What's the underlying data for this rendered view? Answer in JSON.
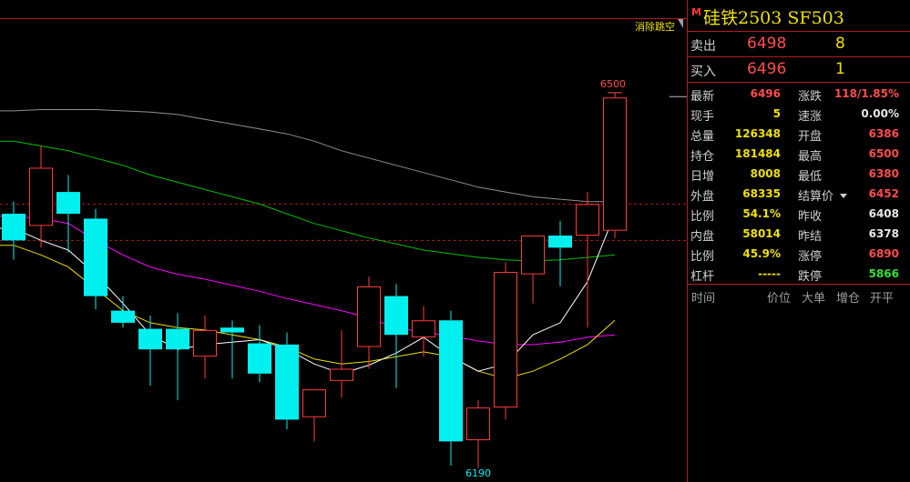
{
  "toolbar": {
    "gap_label": "消除跳空"
  },
  "contract": {
    "m_badge": "M",
    "title": "硅铁2503  SF503"
  },
  "quote": {
    "ask_label": "卖出",
    "ask_price": "6498",
    "ask_vol": "8",
    "bid_label": "买入",
    "bid_price": "6496",
    "bid_vol": "1"
  },
  "stats": {
    "left": [
      {
        "label": "最新",
        "value": "6496",
        "color": "red"
      },
      {
        "label": "现手",
        "value": "5",
        "color": "yellow"
      },
      {
        "label": "总量",
        "value": "126348",
        "color": "yellow"
      },
      {
        "label": "持仓",
        "value": "181484",
        "color": "yellow"
      },
      {
        "label": "日增",
        "value": "8008",
        "color": "yellow"
      },
      {
        "label": "外盘",
        "value": "68335",
        "color": "yellow"
      },
      {
        "label": "比例",
        "value": "54.1%",
        "color": "yellow"
      },
      {
        "label": "内盘",
        "value": "58014",
        "color": "yellow"
      },
      {
        "label": "比例",
        "value": "45.9%",
        "color": "yellow"
      },
      {
        "label": "杠杆",
        "value": "-----",
        "color": "yellow"
      }
    ],
    "right": [
      {
        "label": "涨跌",
        "value": "118/1.85%",
        "color": "red"
      },
      {
        "label": "速涨",
        "value": "0.00%",
        "color": "white"
      },
      {
        "label": "开盘",
        "value": "6386",
        "color": "red"
      },
      {
        "label": "最高",
        "value": "6500",
        "color": "red"
      },
      {
        "label": "最低",
        "value": "6380",
        "color": "red"
      },
      {
        "label": "结算价",
        "value": "6452",
        "color": "red"
      },
      {
        "label": "昨收",
        "value": "6408",
        "color": "white"
      },
      {
        "label": "昨结",
        "value": "6378",
        "color": "white"
      },
      {
        "label": "涨停",
        "value": "6890",
        "color": "red"
      },
      {
        "label": "跌停",
        "value": "5866",
        "color": "green"
      }
    ]
  },
  "ticks_header": {
    "time": "时间",
    "price": "价位",
    "big": "大单",
    "oi_change": "增仓",
    "open_close": "开平"
  },
  "colors": {
    "up": "#ff3b3b",
    "down": "#00f0f0",
    "grid": "#b21c1c",
    "ma5": "#ffffff",
    "ma10": "#f0e000",
    "ma20": "#ff00ff",
    "ma40": "#00c000",
    "ma60": "#909090"
  },
  "chart_labels": {
    "high_label": "6500",
    "low_label": "6190"
  },
  "chart_data": {
    "type": "candlestick",
    "ylim": [
      6180,
      6560
    ],
    "reference_lines": [
      6408,
      6378
    ],
    "candles": [
      {
        "o": 6400,
        "h": 6410,
        "l": 6362,
        "c": 6378
      },
      {
        "o": 6390,
        "h": 6456,
        "l": 6372,
        "c": 6438
      },
      {
        "o": 6418,
        "h": 6432,
        "l": 6368,
        "c": 6400
      },
      {
        "o": 6396,
        "h": 6404,
        "l": 6321,
        "c": 6332
      },
      {
        "o": 6320,
        "h": 6332,
        "l": 6306,
        "c": 6310
      },
      {
        "o": 6305,
        "h": 6316,
        "l": 6258,
        "c": 6288
      },
      {
        "o": 6305,
        "h": 6318,
        "l": 6246,
        "c": 6288
      },
      {
        "o": 6282,
        "h": 6316,
        "l": 6264,
        "c": 6304
      },
      {
        "o": 6306,
        "h": 6312,
        "l": 6264,
        "c": 6302
      },
      {
        "o": 6293,
        "h": 6308,
        "l": 6261,
        "c": 6268
      },
      {
        "o": 6292,
        "h": 6302,
        "l": 6222,
        "c": 6230
      },
      {
        "o": 6232,
        "h": 6252,
        "l": 6212,
        "c": 6255
      },
      {
        "o": 6262,
        "h": 6304,
        "l": 6248,
        "c": 6272
      },
      {
        "o": 6290,
        "h": 6348,
        "l": 6272,
        "c": 6340
      },
      {
        "o": 6332,
        "h": 6342,
        "l": 6256,
        "c": 6300
      },
      {
        "o": 6298,
        "h": 6324,
        "l": 6282,
        "c": 6312
      },
      {
        "o": 6312,
        "h": 6320,
        "l": 6192,
        "c": 6212
      },
      {
        "o": 6213,
        "h": 6246,
        "l": 6190,
        "c": 6240
      },
      {
        "o": 6240,
        "h": 6360,
        "l": 6230,
        "c": 6352
      },
      {
        "o": 6350,
        "h": 6378,
        "l": 6326,
        "c": 6382
      },
      {
        "o": 6382,
        "h": 6394,
        "l": 6340,
        "c": 6372
      },
      {
        "o": 6382,
        "h": 6418,
        "l": 6306,
        "c": 6408
      },
      {
        "o": 6386,
        "h": 6500,
        "l": 6380,
        "c": 6496
      }
    ],
    "ma": {
      "ma5": [
        6388,
        6378,
        6370,
        6350,
        6326,
        6300,
        6288,
        6292,
        6294,
        6296,
        6288,
        6276,
        6268,
        6275,
        6285,
        6298,
        6282,
        6270,
        6276,
        6300,
        6310,
        6344,
        6400
      ],
      "ma10": [
        6374,
        6366,
        6356,
        6338,
        6320,
        6310,
        6306,
        6304,
        6300,
        6296,
        6290,
        6280,
        6276,
        6278,
        6282,
        6286,
        6282,
        6270,
        6264,
        6270,
        6280,
        6292,
        6312
      ],
      "ma20": [
        6398,
        6396,
        6392,
        6378,
        6366,
        6356,
        6350,
        6346,
        6341,
        6336,
        6330,
        6325,
        6320,
        6314,
        6306,
        6302,
        6299,
        6295,
        6292,
        6292,
        6294,
        6298,
        6300
      ],
      "ma40": [
        6460,
        6456,
        6452,
        6446,
        6440,
        6432,
        6426,
        6420,
        6414,
        6408,
        6400,
        6392,
        6386,
        6380,
        6375,
        6370,
        6367,
        6364,
        6362,
        6361,
        6362,
        6364,
        6366
      ],
      "ma60": [
        6485,
        6486,
        6486,
        6486,
        6485,
        6484,
        6482,
        6478,
        6474,
        6470,
        6466,
        6460,
        6452,
        6446,
        6440,
        6434,
        6428,
        6422,
        6418,
        6414,
        6412,
        6410,
        6410
      ]
    }
  }
}
